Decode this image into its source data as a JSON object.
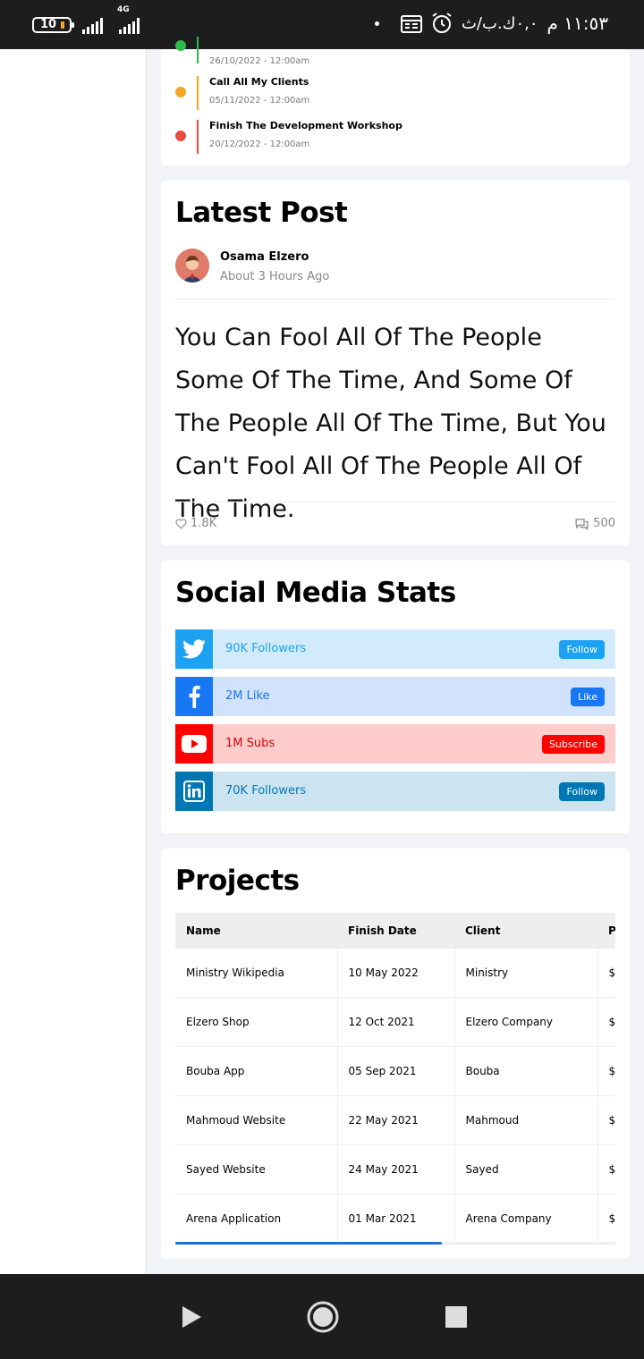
{
  "status_bar": {
    "battery": "10",
    "network": "4G",
    "time": "١١:٥٣ م",
    "speed": "٠,٠ك.ب/ث"
  },
  "timeline": {
    "items": [
      {
        "title": "",
        "date": "26/10/2022 - 12:00am",
        "color": "#2ebd4a"
      },
      {
        "title": "Call All My Clients",
        "date": "05/11/2022 - 12:00am",
        "color": "#f5a623"
      },
      {
        "title": "Finish The Development Workshop",
        "date": "20/12/2022 - 12:00am",
        "color": "#e74c3c"
      }
    ]
  },
  "latest_post": {
    "title": "Latest Post",
    "author": "Osama Elzero",
    "time": "About 3 Hours Ago",
    "quote": "You Can Fool All Of The People Some Of The Time, And Some Of The People All Of The Time, But You Can't Fool All Of The People All Of The Time.",
    "likes": "1.8K",
    "comments": "500"
  },
  "social": {
    "title": "Social Media Stats",
    "rows": [
      {
        "network": "twitter",
        "icon": "twitter-icon",
        "text": "90K Followers",
        "button": "Follow",
        "color": "#1da1f2",
        "bg": "#d2ebfc"
      },
      {
        "network": "facebook",
        "icon": "facebook-icon",
        "text": "2M Like",
        "button": "Like",
        "color": "#1877f2",
        "bg": "#d1e3fc"
      },
      {
        "network": "youtube",
        "icon": "youtube-icon",
        "text": "1M Subs",
        "button": "Subscribe",
        "color": "#ff0000",
        "bg": "#ffcccc"
      },
      {
        "network": "linkedin",
        "icon": "linkedin-icon",
        "text": "70K Followers",
        "button": "Follow",
        "color": "#0077b5",
        "bg": "#cce4f0"
      }
    ]
  },
  "projects": {
    "title": "Projects",
    "columns": [
      "Name",
      "Finish Date",
      "Client",
      "Price"
    ],
    "rows": [
      {
        "name": "Ministry Wikipedia",
        "date": "10 May 2022",
        "client": "Ministry",
        "price": "$"
      },
      {
        "name": "Elzero Shop",
        "date": "12 Oct 2021",
        "client": "Elzero Company",
        "price": "$"
      },
      {
        "name": "Bouba App",
        "date": "05 Sep 2021",
        "client": "Bouba",
        "price": "$"
      },
      {
        "name": "Mahmoud Website",
        "date": "22 May 2021",
        "client": "Mahmoud",
        "price": "$"
      },
      {
        "name": "Sayed Website",
        "date": "24 May 2021",
        "client": "Sayed",
        "price": "$"
      },
      {
        "name": "Arena Application",
        "date": "01 Mar 2021",
        "client": "Arena Company",
        "price": "$"
      }
    ]
  },
  "colors": {
    "accent": "#1f6fd1"
  }
}
